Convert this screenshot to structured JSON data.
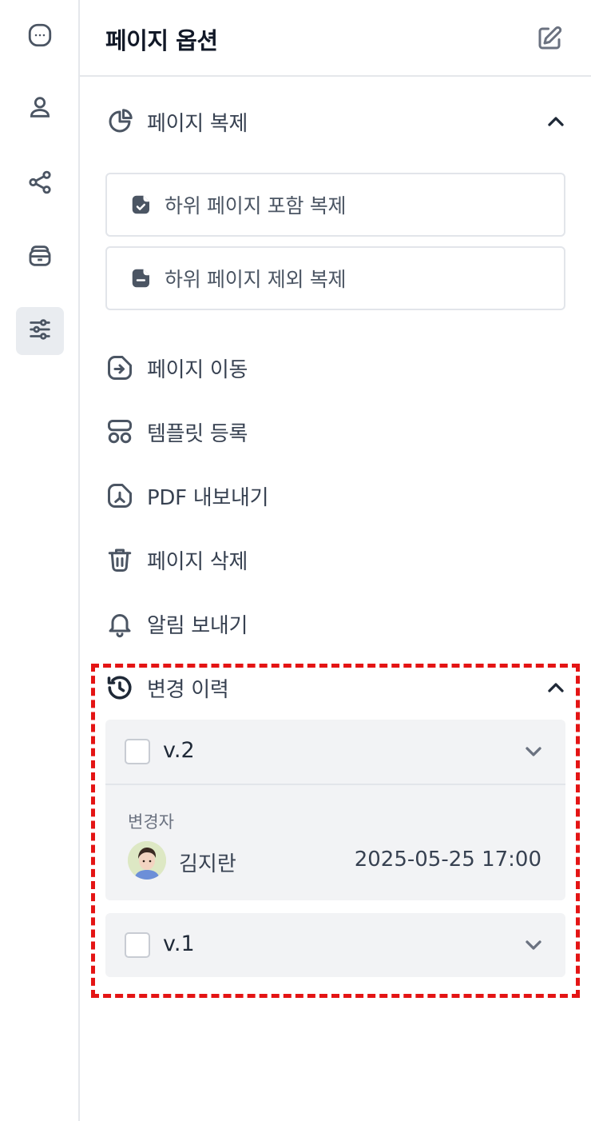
{
  "panel": {
    "title": "페이지 옵션",
    "duplicate": {
      "label": "페이지 복제",
      "with_children": "하위 페이지 포함 복제",
      "without_children": "하위 페이지 제외 복제"
    },
    "actions": {
      "move": "페이지 이동",
      "template": "템플릿 등록",
      "export_pdf": "PDF 내보내기",
      "delete": "페이지 삭제",
      "notify": "알림 보내기"
    },
    "history": {
      "label": "변경 이력",
      "versions": [
        {
          "label": "v.2",
          "expanded": true,
          "changer_label": "변경자",
          "changer_name": "김지란",
          "changed_at": "2025-05-25 17:00"
        },
        {
          "label": "v.1",
          "expanded": false
        }
      ]
    }
  },
  "rail": {
    "items": [
      "chat-icon",
      "user-icon",
      "share-icon",
      "archive-icon",
      "settings-sliders-icon"
    ],
    "active": "settings-sliders-icon"
  },
  "colors": {
    "icon": "#4b5563",
    "active_bg": "#e9ecf0",
    "card_bg": "#f2f3f5",
    "highlight": "#e41414"
  }
}
